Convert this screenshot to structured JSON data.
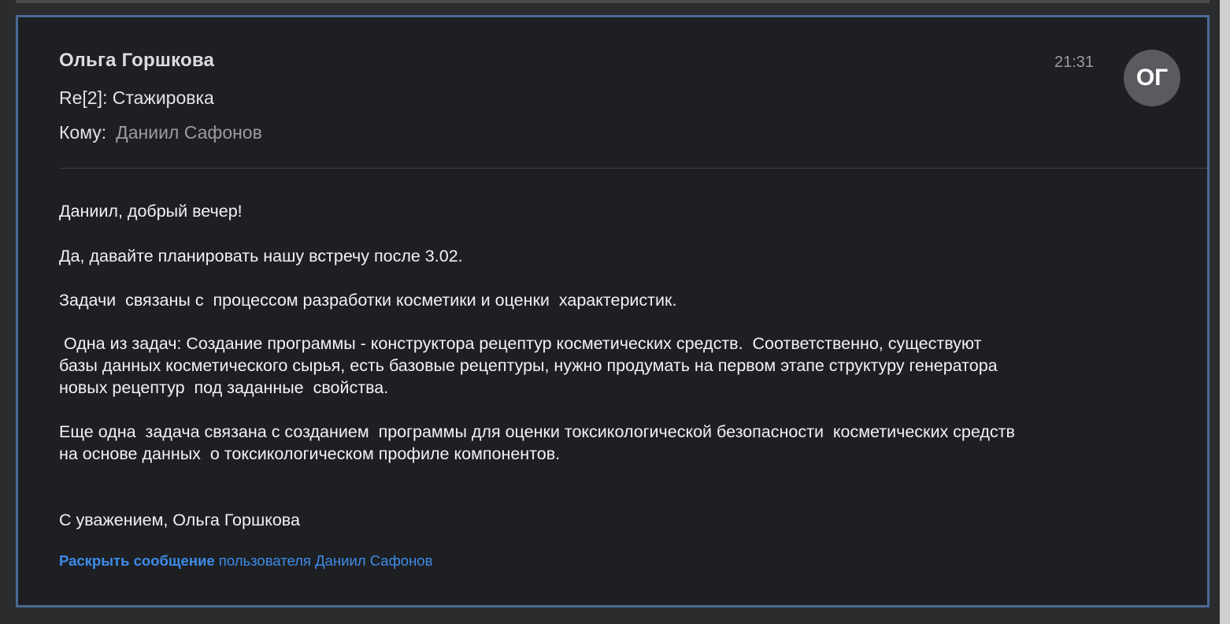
{
  "message": {
    "sender": "Ольга Горшкова",
    "subject": "Re[2]: Стажировка",
    "to_label": "Кому:",
    "to_name": "Даниил Сафонов",
    "time": "21:31",
    "avatar_initials": "ОГ"
  },
  "body": {
    "greeting": "Даниил, добрый вечер!",
    "line2": "Да, давайте планировать нашу встречу после 3.02.",
    "line3": "Задачи  связаны с  процессом разработки косметики и оценки  характеристик.",
    "line4": " Одна из задач: Создание программы - конструктора рецептур косметических средств.  Соответственно, существуют\nбазы данных косметического сырья, есть базовые рецептуры, нужно продумать на первом этапе структуру генератора\nновых рецептур  под заданные  свойства.",
    "line5": "Еще одна  задача связана с созданием  программы для оценки токсикологической безопасности  косметических средств\nна основе данных  о токсикологическом профиле компонентов.",
    "signature": "С уважением, Ольга Горшкова"
  },
  "expand": {
    "link_label": "Раскрыть сообщение",
    "rest_text": " пользователя Даниил Сафонов"
  },
  "colors": {
    "background": "#1e1f22",
    "frame_border": "#4a6a95",
    "link": "#3d8be8",
    "avatar": "#5a5b5f"
  }
}
